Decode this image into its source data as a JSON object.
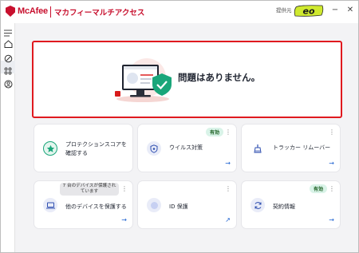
{
  "titlebar": {
    "brand": "McAfee",
    "app_title": "マカフィーマルチアクセス",
    "provider_label": "提供元",
    "provider_logo_text": "eo",
    "minimize": "−",
    "close": "✕"
  },
  "sidebar": {
    "icons": [
      "menu-icon",
      "home-icon",
      "protection-icon",
      "apps-icon",
      "account-icon"
    ]
  },
  "hero": {
    "status_text": "問題はありません。"
  },
  "cards": [
    {
      "label": "プロテクションスコアを確認する",
      "icon": "star-shield-icon",
      "badge": "",
      "note": ""
    },
    {
      "label": "ウイルス対策",
      "icon": "shield-icon",
      "badge": "有効",
      "note": ""
    },
    {
      "label": "トラッカー リムーバー",
      "icon": "broom-icon",
      "badge": "",
      "note": ""
    },
    {
      "label": "他のデバイスを保護する",
      "icon": "devices-icon",
      "badge": "",
      "note": "7 台のデバイスが保護されています"
    },
    {
      "label": "ID 保護",
      "icon": "id-icon",
      "badge": "",
      "note": ""
    },
    {
      "label": "契約情報",
      "icon": "refresh-icon",
      "badge": "有効",
      "note": ""
    }
  ],
  "colors": {
    "brand": "#c8102e",
    "hero_border": "#e0191f",
    "badge_bg": "#d9f3e8",
    "link": "#1a5fd0"
  }
}
